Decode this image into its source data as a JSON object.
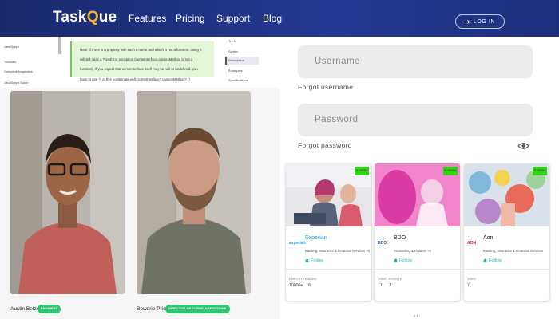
{
  "header": {
    "logo_prefix": "Task",
    "logo_q": "Q",
    "logo_suffix": "ue",
    "nav": [
      "Features",
      "Pricing",
      "Support",
      "Blog"
    ],
    "login_label": "LOG IN"
  },
  "docs": {
    "sidebar": [
      "JavaScript",
      "Tutorials",
      "Complete beginners",
      "JavaScript Guide"
    ],
    "note_lines": [
      "Note: If there is a property with such a name and which is not a function, using ?.",
      "will still raise a TypeError exception (someInterface.customMethod is not a",
      "function). If you expect that someInterface itself may be null or undefined, you",
      "have to use ?. at this position as well: someInterface?.customMethod?.()"
    ],
    "right_nav": [
      "Try it",
      "Syntax",
      "Description",
      "Examples",
      "Specifications"
    ],
    "right_active": "Description"
  },
  "people": [
    {
      "name": "Austin Betzer",
      "badge": "ENGINEER"
    },
    {
      "name": "Bowdrie Price",
      "badge": "DIRECTOR OF CLIENT OPERATIONS"
    }
  ],
  "form": {
    "username_placeholder": "Username",
    "forgot_username": "Forgot username",
    "password_placeholder": "Password",
    "forgot_password": "Forgot password"
  },
  "companies": [
    {
      "badge": "IS HIRING",
      "logo_text": "experian",
      "name": "Experian",
      "industry": "Banking, Insurance & Financial Services +5",
      "follow": "Follow",
      "stats": [
        {
          "label": "EMPLOYEES",
          "value": "10000+"
        },
        {
          "label": "JOBS",
          "value": "6"
        }
      ],
      "accent": "#2fa4d9"
    },
    {
      "badge": "IS HIRING",
      "logo_text": "BDO",
      "name": "BDO",
      "industry": "Accounting & Finance +3",
      "follow": "Follow",
      "stats": [
        {
          "label": "JOBS",
          "value": "17"
        },
        {
          "label": "EVENTS",
          "value": "1"
        }
      ],
      "accent": "#ec1c74"
    },
    {
      "badge": "IS HIRING",
      "logo_text": "AON",
      "name": "Aon",
      "industry": "Banking, Insurance & Financial Services",
      "follow": "Follow",
      "stats": [
        {
          "label": "JOBS",
          "value": "7"
        }
      ],
      "accent": "#e11b22"
    }
  ],
  "pager": "‹ ›",
  "colors": {
    "header": "#1e2f7d",
    "badge_green": "#2ec56f",
    "hiring_green": "#33d11a",
    "follow_teal": "#35b0b3"
  }
}
